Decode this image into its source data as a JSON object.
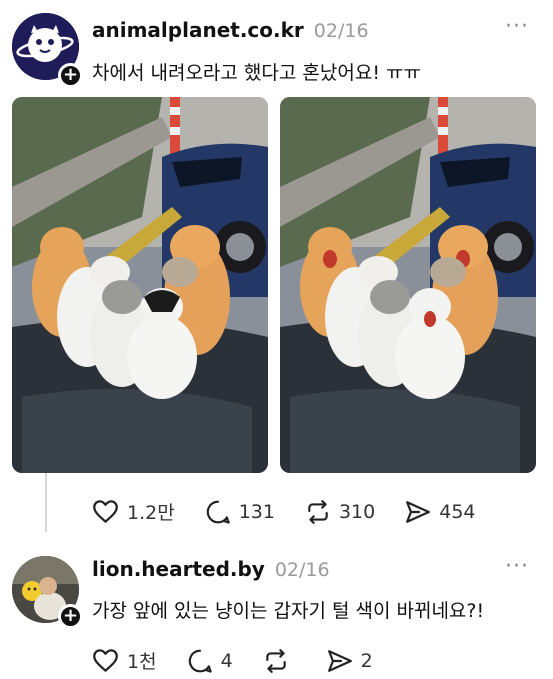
{
  "posts": [
    {
      "username": "animalplanet.co.kr",
      "timestamp": "02/16",
      "text": "차에서 내려오라고 했다고 혼났어요! ㅠㅠ",
      "stats": {
        "likes": "1.2만",
        "replies": "131",
        "reposts": "310",
        "shares": "454"
      }
    },
    {
      "username": "lion.hearted.by",
      "timestamp": "02/16",
      "text": "가장 앞에 있는 냥이는 갑자기 털 색이 바뀌네요?!",
      "stats": {
        "likes": "1천",
        "replies": "4",
        "reposts": "",
        "shares": "2"
      }
    }
  ],
  "ui": {
    "more_glyph": "···",
    "follow_glyph": "+"
  },
  "icons": [
    "heart-icon",
    "comment-icon",
    "repost-icon",
    "share-icon",
    "more-icon",
    "plus-icon"
  ],
  "colors": {
    "text": "#111111",
    "muted": "#9a9a9a",
    "thread_line": "#d6d6d6"
  }
}
